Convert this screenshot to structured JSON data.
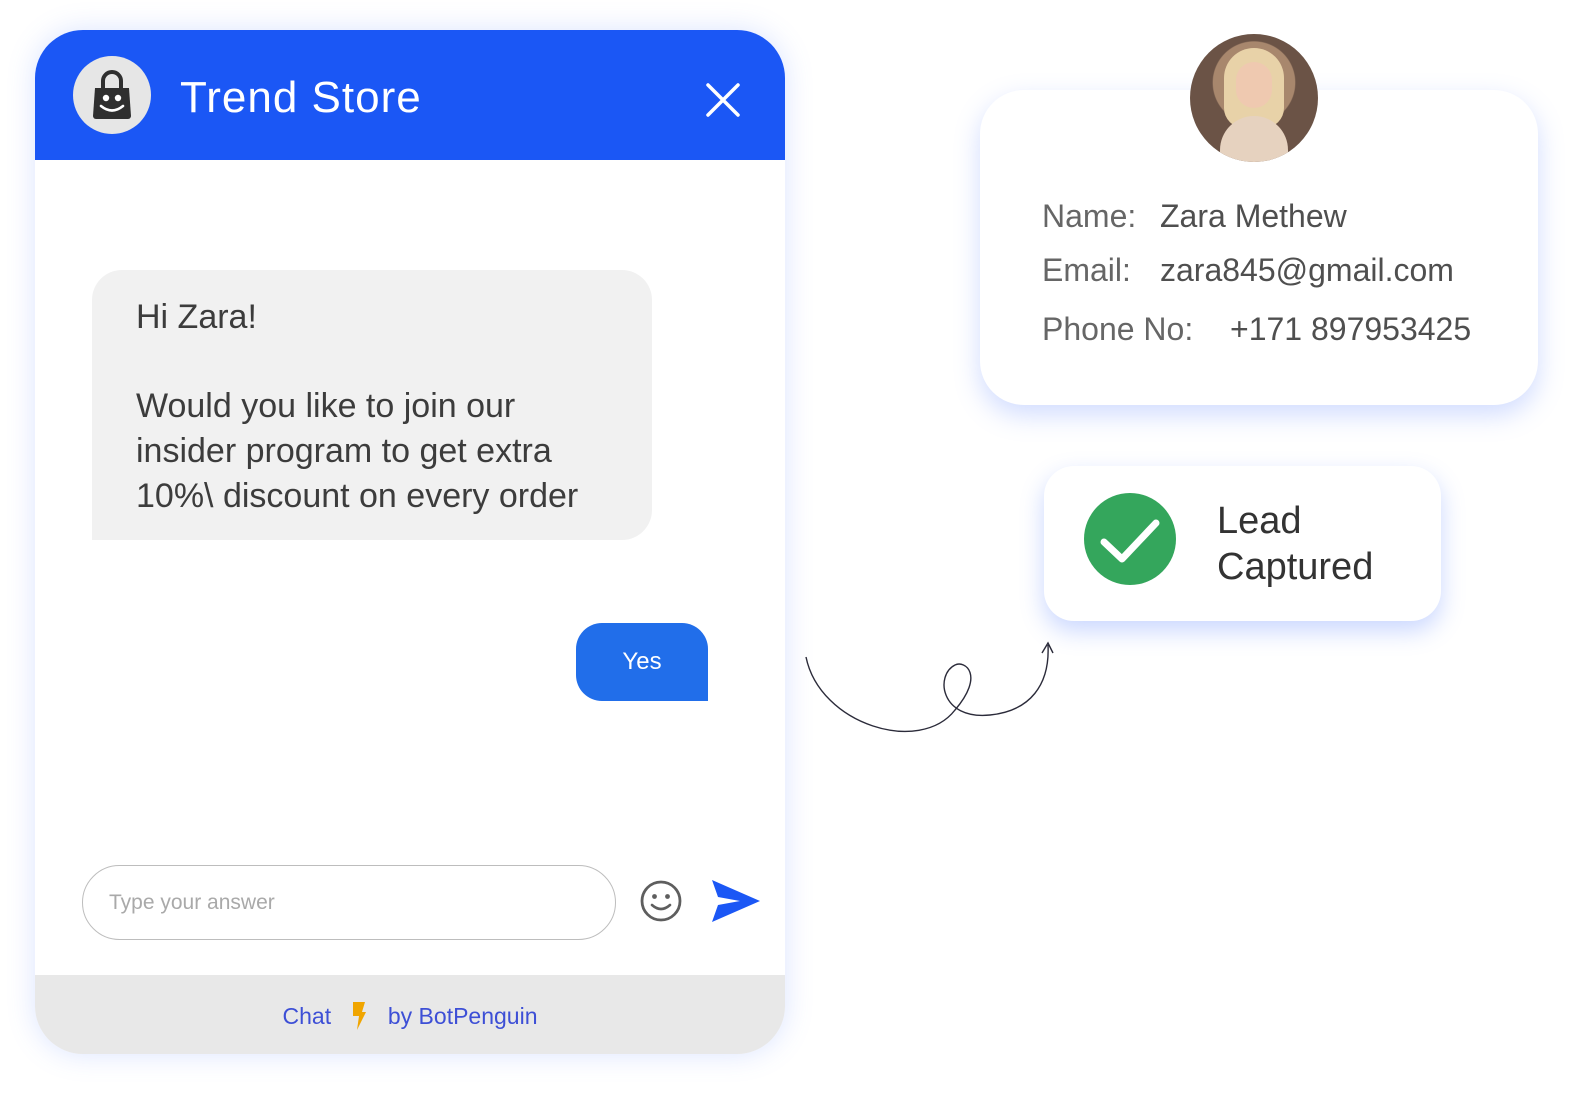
{
  "chat": {
    "title": "Trend Store",
    "logo_icon": "shopping-bag-smile-icon",
    "close_icon": "close-icon",
    "bot_message": {
      "greeting": "Hi Zara!",
      "lines": [
        "Would you like to join our",
        "insider program to get extra",
        "10%\\ discount on every order"
      ]
    },
    "user_reply": "Yes",
    "input": {
      "placeholder": "Type your answer",
      "value": ""
    },
    "emoji_icon": "smiley-icon",
    "send_icon": "send-icon",
    "footer": {
      "prefix": "Chat",
      "bolt_icon": "lightning-bolt-icon",
      "suffix": "by BotPenguin"
    }
  },
  "profile": {
    "avatar_alt": "Zara Methew profile photo",
    "fields": [
      {
        "label": "Name:",
        "value": "Zara Methew"
      },
      {
        "label": "Email:",
        "value": "zara845@gmail.com"
      },
      {
        "label": "Phone No:",
        "value": "+171 897953425"
      }
    ]
  },
  "lead_status": {
    "icon": "check-circle-icon",
    "line1": "Lead",
    "line2": "Captured"
  },
  "colors": {
    "brand_blue": "#1b57f5",
    "reply_blue": "#216eea",
    "success_green": "#34a65c",
    "bolt_orange": "#f0a500",
    "footer_link": "#3d4fd6"
  }
}
